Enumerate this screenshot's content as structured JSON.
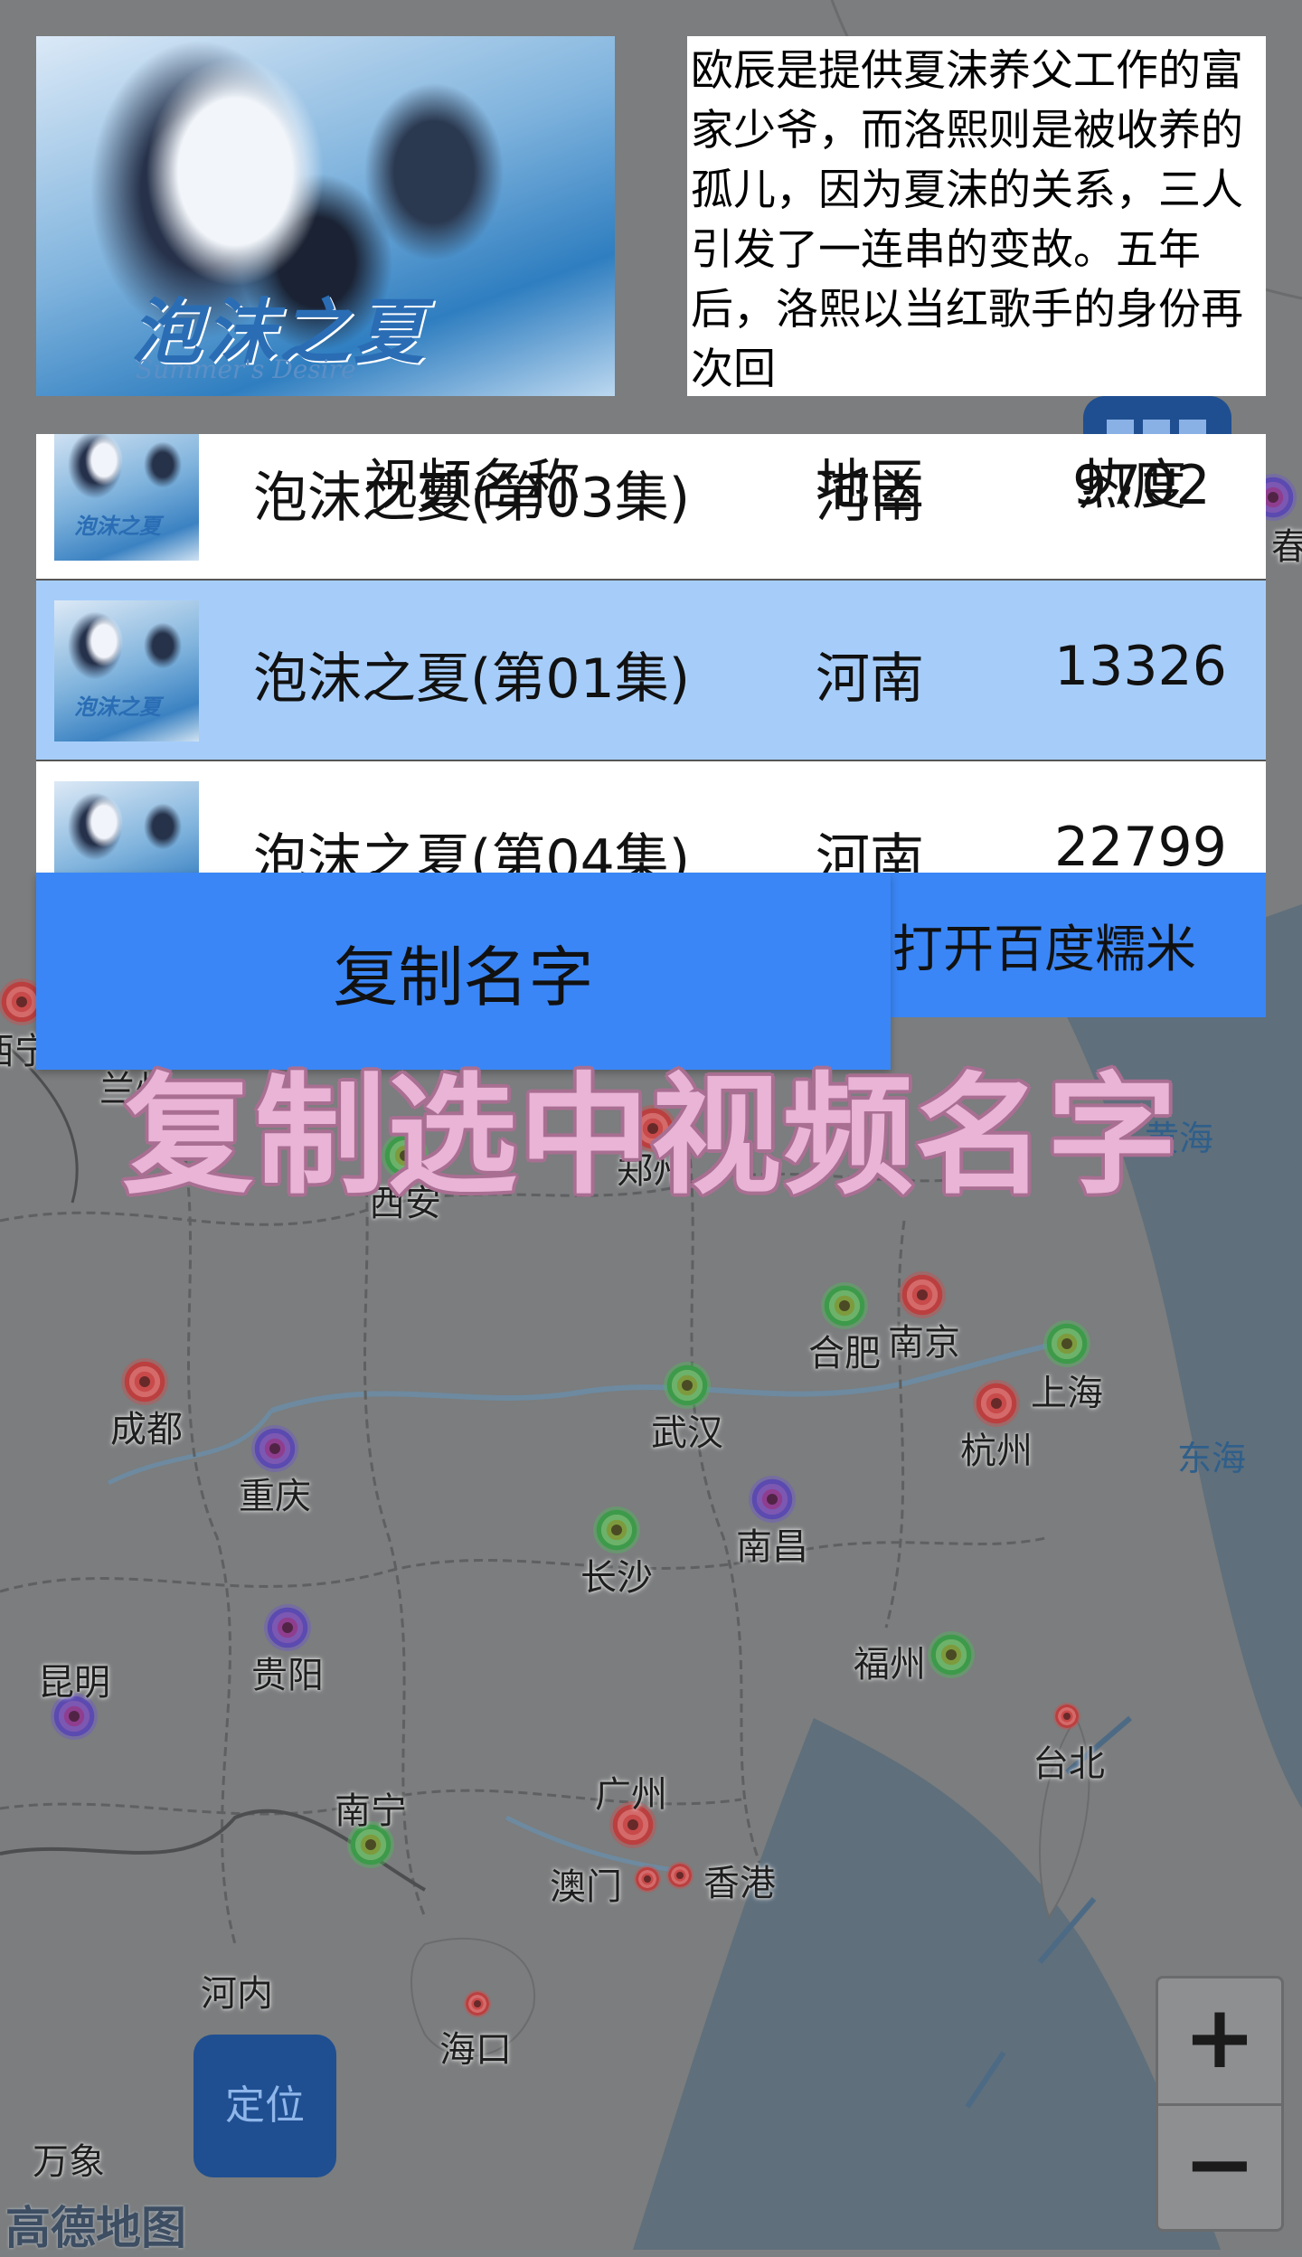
{
  "description": "欧辰是提供夏沫养父工作的富家少爷，而洛熙则是被收养的孤儿，因为夏沫的关系，三人引发了一连串的变故。五年后，洛熙以当红歌手的身份再次回",
  "poster": {
    "title": "泡沫之夏",
    "subtitle": "Summer's Desire"
  },
  "table": {
    "headers": {
      "name": "视频名称",
      "region": "地区",
      "heat": "热度"
    },
    "rows": [
      {
        "name": "泡沫之夏(第03集)",
        "region": "河南",
        "heat": "9702",
        "selected": false
      },
      {
        "name": "泡沫之夏(第01集)",
        "region": "河南",
        "heat": "13326",
        "selected": true
      },
      {
        "name": "泡沫之夏(第04集)",
        "region": "河南",
        "heat": "22799",
        "selected": false
      }
    ]
  },
  "buttons": {
    "copy_name": "复制名字",
    "open_baidu_nuomi": "打开百度糯米",
    "locate": "定位",
    "zoom_in": "+",
    "zoom_out": "−"
  },
  "banner": "复制选中视频名字",
  "map": {
    "provider_logo": "高德地图",
    "seas": [
      "东海",
      "黄海"
    ],
    "cities": [
      {
        "name": "西宁",
        "marker": "red"
      },
      {
        "name": "兰州",
        "marker": "none"
      },
      {
        "name": "郑州",
        "marker": "red"
      },
      {
        "name": "西安",
        "marker": "green"
      },
      {
        "name": "合肥",
        "marker": "green"
      },
      {
        "name": "南京",
        "marker": "red"
      },
      {
        "name": "成都",
        "marker": "red"
      },
      {
        "name": "上海",
        "marker": "green"
      },
      {
        "name": "武汉",
        "marker": "green"
      },
      {
        "name": "杭州",
        "marker": "red"
      },
      {
        "name": "重庆",
        "marker": "purple"
      },
      {
        "name": "南昌",
        "marker": "purple"
      },
      {
        "name": "长沙",
        "marker": "green"
      },
      {
        "name": "贵阳",
        "marker": "purple"
      },
      {
        "name": "昆明",
        "marker": "purple"
      },
      {
        "name": "福州",
        "marker": "green"
      },
      {
        "name": "台北",
        "marker": "red"
      },
      {
        "name": "南宁",
        "marker": "green"
      },
      {
        "name": "广州",
        "marker": "red"
      },
      {
        "name": "澳门",
        "marker": "red"
      },
      {
        "name": "香港",
        "marker": "red"
      },
      {
        "name": "河内",
        "marker": "none"
      },
      {
        "name": "海口",
        "marker": "red"
      },
      {
        "name": "万象",
        "marker": "none"
      },
      {
        "name": "春",
        "marker": "purple"
      }
    ]
  }
}
